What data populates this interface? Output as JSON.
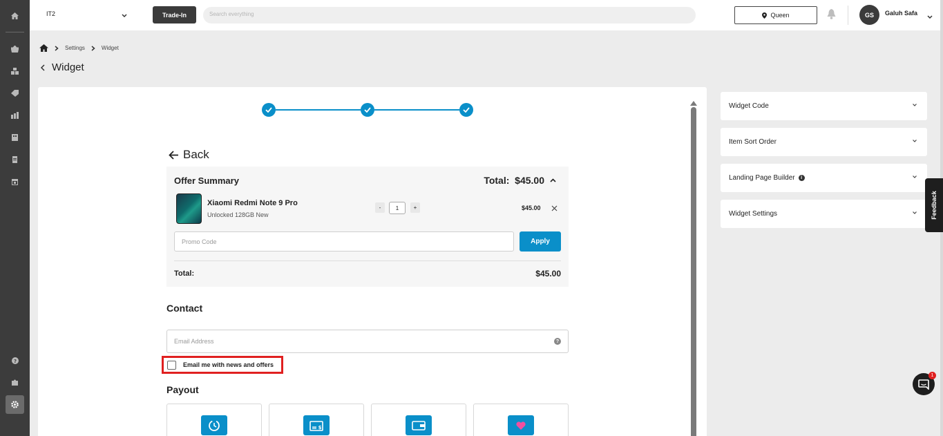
{
  "topbar": {
    "store": "IT2",
    "trade_in": "Trade-In",
    "search_placeholder": "Search everything",
    "location": "Queen",
    "user_initials": "GS",
    "user_name": "Galuh Safa"
  },
  "breadcrumb": {
    "level1": "Settings",
    "level2": "Widget"
  },
  "page": {
    "title": "Widget"
  },
  "checkout": {
    "back": "Back",
    "summary_title": "Offer Summary",
    "total_header": "Total:  $45.00",
    "item": {
      "name": "Xiaomi Redmi Note 9 Pro",
      "variant": "Unlocked 128GB New",
      "qty": "1",
      "minus": "-",
      "plus": "+",
      "price": "$45.00"
    },
    "promo_placeholder": "Promo Code",
    "apply": "Apply",
    "total_label": "Total:",
    "total_value": "$45.00",
    "contact_heading": "Contact",
    "email_placeholder": "Email Address",
    "optin_label": "Email me with news and offers",
    "payout_heading": "Payout"
  },
  "panels": [
    {
      "label": "Widget Code"
    },
    {
      "label": "Item Sort Order"
    },
    {
      "label": "Landing Page Builder"
    },
    {
      "label": "Widget Settings"
    }
  ],
  "feedback": "Feedback",
  "chat_badge": "1",
  "colors": {
    "accent": "#0a8fc9",
    "highlight": "#e02020",
    "dark": "#3b3b3b"
  }
}
